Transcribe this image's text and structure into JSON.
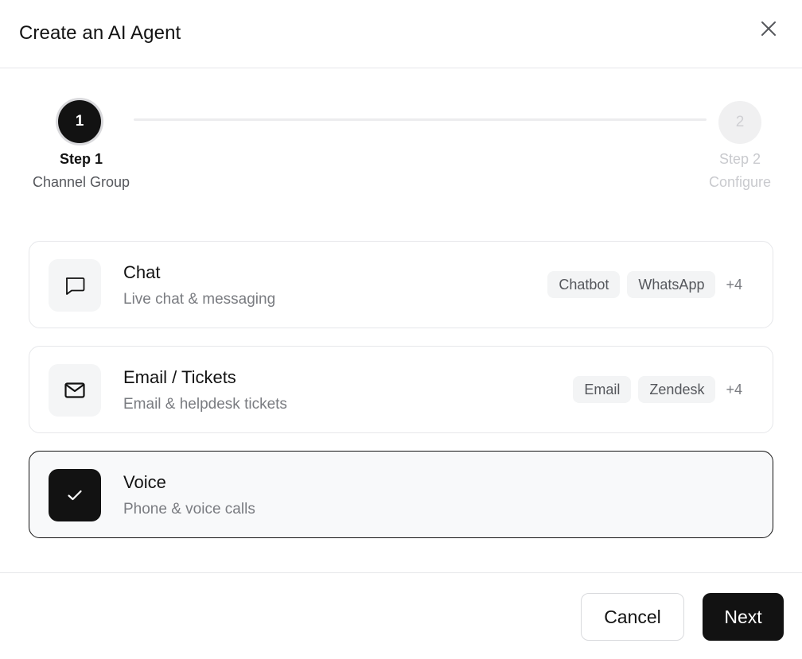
{
  "dialog": {
    "title": "Create an AI Agent",
    "close_icon": "close-icon"
  },
  "stepper": {
    "steps": [
      {
        "number": "1",
        "title": "Step 1",
        "subtitle": "Channel Group",
        "state": "active"
      },
      {
        "number": "2",
        "title": "Step 2",
        "subtitle": "Configure",
        "state": "inactive"
      }
    ]
  },
  "channels": [
    {
      "title": "Chat",
      "description": "Live chat & messaging",
      "icon": "chat-bubble-icon",
      "tags": [
        "Chatbot",
        "WhatsApp"
      ],
      "more": "+4",
      "selected": false
    },
    {
      "title": "Email / Tickets",
      "description": "Email & helpdesk tickets",
      "icon": "mail-icon",
      "tags": [
        "Email",
        "Zendesk"
      ],
      "more": "+4",
      "selected": false
    },
    {
      "title": "Voice",
      "description": "Phone & voice calls",
      "icon": "check-icon",
      "tags": [],
      "more": "",
      "selected": true
    }
  ],
  "footer": {
    "cancel_label": "Cancel",
    "next_label": "Next"
  },
  "colors": {
    "primary": "#121212",
    "border": "#e6e7ea",
    "muted_text": "#7a7c81",
    "tag_bg": "#f3f4f5"
  }
}
